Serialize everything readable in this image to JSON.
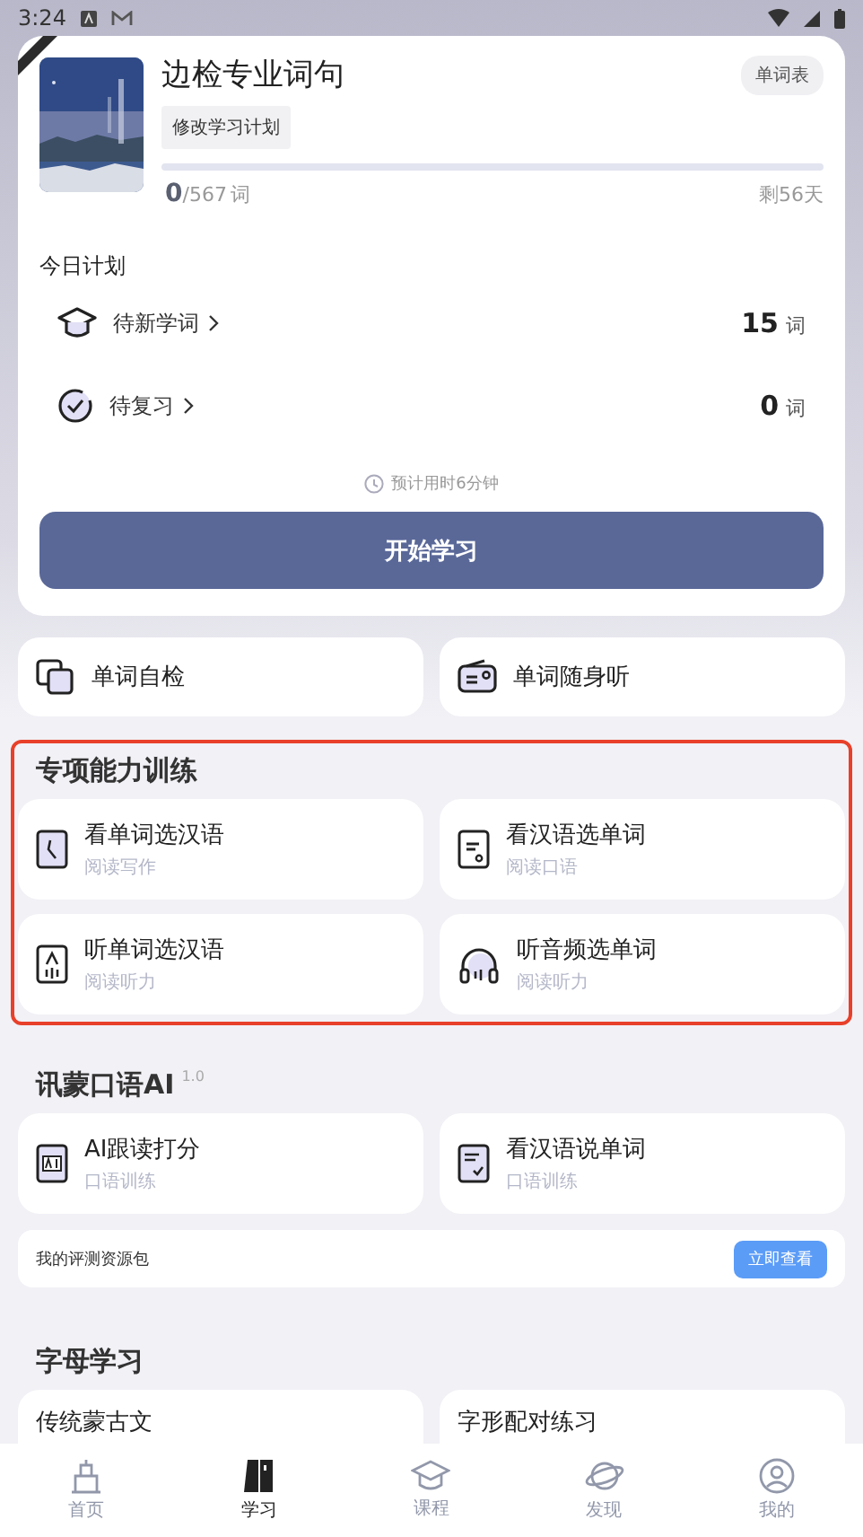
{
  "status_bar": {
    "time": "3:24"
  },
  "book": {
    "title": "边检专业词句",
    "word_list_button": "单词表",
    "plan_button": "修改学习计划",
    "learned": "0",
    "total": "/567",
    "unit": "词",
    "level": 0,
    "remaining": "剩56天"
  },
  "today_plan": {
    "title": "今日计划",
    "items": [
      {
        "kind": "new",
        "label": "待新学词",
        "count": "15",
        "unit": "词"
      },
      {
        "kind": "review",
        "label": "待复习",
        "count": "0",
        "unit": "词"
      }
    ],
    "estimate": "预计用时6分钟",
    "start_button": "开始学习"
  },
  "quick_tools": [
    {
      "kind": "cards",
      "label": "单词自检"
    },
    {
      "kind": "radio",
      "label": "单词随身听"
    }
  ],
  "sections": [
    {
      "title": "专项能力训练",
      "highlighted": true,
      "tiles": [
        {
          "kind": "read",
          "label": "看单词选汉语",
          "sub": "阅读写作"
        },
        {
          "kind": "doc",
          "label": "看汉语选单词",
          "sub": "阅读口语"
        },
        {
          "kind": "listen",
          "label": "听单词选汉语",
          "sub": "阅读听力"
        },
        {
          "kind": "headphones",
          "label": "听音频选单词",
          "sub": "阅读听力"
        }
      ]
    },
    {
      "title": "讯蒙口语AI",
      "version": "1.0",
      "highlighted": false,
      "tiles": [
        {
          "kind": "ai",
          "label": "AI跟读打分",
          "sub": "口语训练"
        },
        {
          "kind": "check",
          "label": "看汉语说单词",
          "sub": "口语训练"
        }
      ],
      "resource": {
        "label": "我的评测资源包",
        "button": "立即查看"
      }
    },
    {
      "title": "字母学习",
      "highlighted": false,
      "tiles": [
        {
          "kind": "plain",
          "label": "传统蒙古文"
        },
        {
          "kind": "plain",
          "label": "字形配对练习"
        }
      ]
    }
  ],
  "nav": [
    {
      "kind": "home",
      "label": "首页",
      "selected": false
    },
    {
      "kind": "study",
      "label": "学习",
      "selected": true
    },
    {
      "kind": "course",
      "label": "课程",
      "selected": false
    },
    {
      "kind": "discover",
      "label": "发现",
      "selected": false
    },
    {
      "kind": "me",
      "label": "我的",
      "selected": false
    }
  ]
}
